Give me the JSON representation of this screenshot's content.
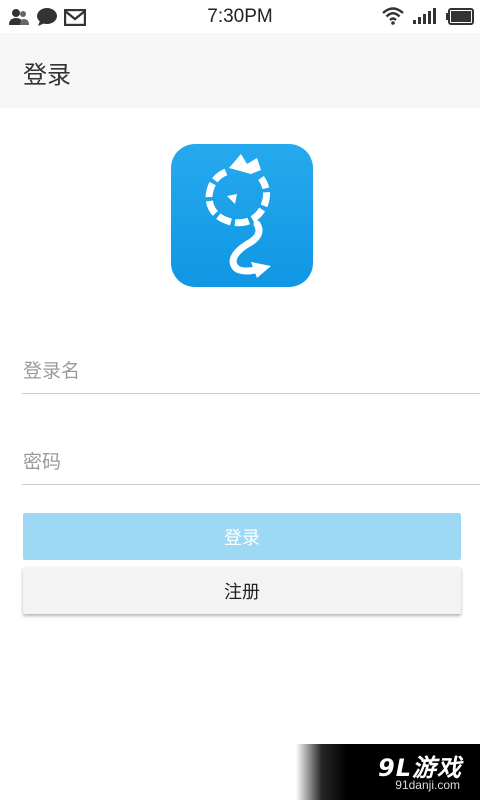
{
  "status_bar": {
    "time": "7:30PM",
    "left_icons": [
      "contacts-icon",
      "chat-bubble-icon",
      "mail-icon"
    ],
    "right_icons": [
      "wifi-icon",
      "signal-icon",
      "battery-icon"
    ]
  },
  "header": {
    "title": "登录"
  },
  "logo": {
    "icon": "app-logo-icon",
    "color": "#1ba1e9"
  },
  "form": {
    "username_placeholder": "登录名",
    "password_placeholder": "密码",
    "login_label": "登录",
    "register_label": "注册"
  },
  "colors": {
    "login_button": "#9dd8f5",
    "register_button": "#f3f3f3",
    "header_bg": "#f7f7f7"
  },
  "watermark": {
    "brand": "9L游戏",
    "url": "91danji.com"
  }
}
